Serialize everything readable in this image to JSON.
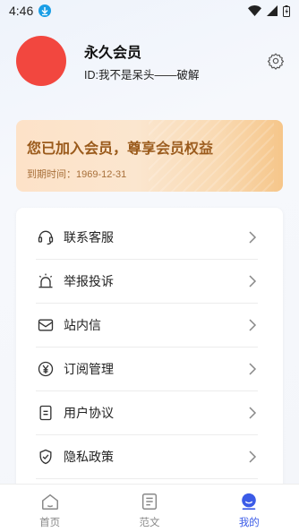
{
  "status_bar": {
    "time": "4:46"
  },
  "profile": {
    "member_title": "永久会员",
    "user_id": "ID:我不是呆头——破解"
  },
  "vip_card": {
    "headline": "您已加入会员，尊享会员权益",
    "expire": "到期时间：1969-12-31"
  },
  "menu": {
    "items": [
      {
        "label": "联系客服",
        "icon": "headset-icon"
      },
      {
        "label": "举报投诉",
        "icon": "alarm-icon"
      },
      {
        "label": "站内信",
        "icon": "mail-icon"
      },
      {
        "label": "订阅管理",
        "icon": "yen-icon"
      },
      {
        "label": "用户协议",
        "icon": "document-icon"
      },
      {
        "label": "隐私政策",
        "icon": "shield-icon"
      }
    ]
  },
  "tab_bar": {
    "tabs": [
      {
        "label": "首页",
        "icon": "home-icon",
        "active": false
      },
      {
        "label": "范文",
        "icon": "article-icon",
        "active": false
      },
      {
        "label": "我的",
        "icon": "user-icon",
        "active": true
      }
    ],
    "active_color": "#3b5be7",
    "inactive_color": "#888888"
  },
  "colors": {
    "avatar": "#f2473f",
    "vip_text": "#9a5a1b"
  }
}
